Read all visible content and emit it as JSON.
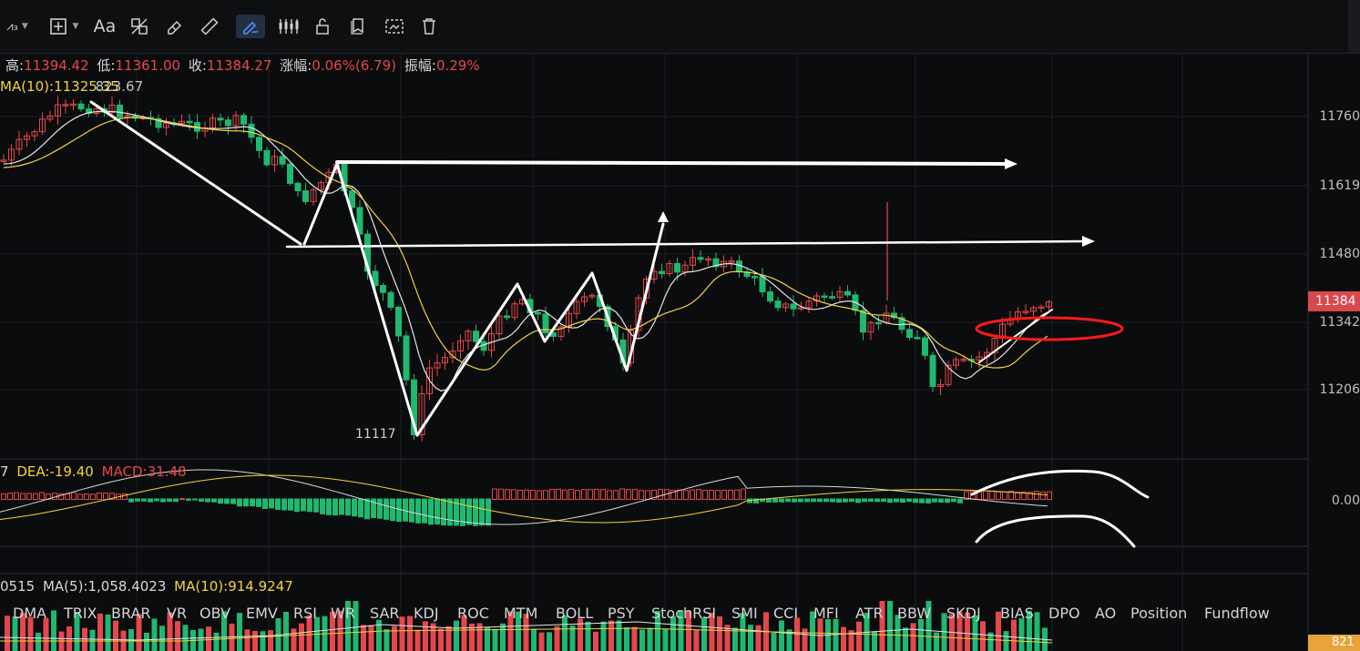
{
  "toolbar": {
    "tools": [
      {
        "name": "line-tool-icon",
        "label": "⩘₃"
      },
      {
        "name": "crosshair-add-icon",
        "label": ""
      },
      {
        "name": "text-tool-icon",
        "label": "Aa"
      },
      {
        "name": "pattern-tool-icon",
        "label": ""
      },
      {
        "name": "eraser-icon",
        "label": ""
      },
      {
        "name": "ruler-icon",
        "label": ""
      },
      {
        "name": "pen-drawing-icon",
        "label": ""
      },
      {
        "name": "candles-icon",
        "label": ""
      },
      {
        "name": "lock-icon",
        "label": ""
      },
      {
        "name": "hide-drawings-icon",
        "label": ""
      },
      {
        "name": "screenshot-icon",
        "label": ""
      },
      {
        "name": "trash-icon",
        "label": ""
      }
    ]
  },
  "ohlc": {
    "high_label": "高:",
    "high_value": "11394.42",
    "low_label": "低:",
    "low_value": "11361.00",
    "close_label": "收:",
    "close_value": "11384.27",
    "change_label": "涨幅:",
    "change_value": "0.06%(6.79)",
    "amp_label": "振幅:",
    "amp_value": "0.29%"
  },
  "ma": {
    "ma10_label": "MA(10):",
    "ma10_value": "11325.35",
    "ma_other": "823.67"
  },
  "price_axis": {
    "ticks": [
      "11760",
      "11619",
      "11480",
      "11342",
      "11206"
    ],
    "current": "11384"
  },
  "annotations": {
    "low_point": "11117"
  },
  "macd": {
    "dif_partial": "7",
    "dea_label": "DEA:",
    "dea_value": "-19.40",
    "macd_label": "MACD:",
    "macd_value": "31.48",
    "zero_tick": "0.00"
  },
  "indicator_tabs": [
    "DMA",
    "TRIX",
    "BRAR",
    "VR",
    "OBV",
    "EMV",
    "RSI",
    "WR",
    "SAR",
    "KDJ",
    "ROC",
    "MTM",
    "BOLL",
    "PSY",
    "StochRSI",
    "SMI",
    "CCI",
    "MFI",
    "ATR",
    "BBW",
    "SKDJ",
    "BIAS",
    "DPO",
    "AO",
    "Position",
    "Fundflow"
  ],
  "volume": {
    "vol_partial": "0515",
    "ma5_label": "MA(5):",
    "ma5_value": "1,058.4023",
    "ma10_label": "MA(10):",
    "ma10_value": "914.9247",
    "tag": "821"
  },
  "colors": {
    "up": "#e5474a",
    "down": "#1fb870",
    "ma_white": "#e6e6e6",
    "ma_yellow": "#f1d33c",
    "annotation_red": "#ff1a1a"
  }
}
